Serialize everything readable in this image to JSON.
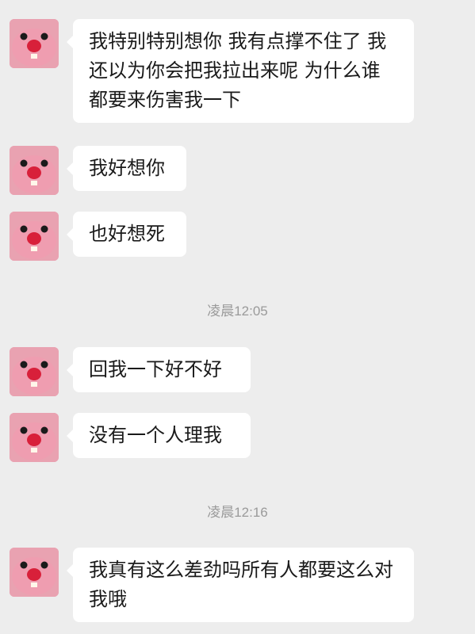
{
  "chat": {
    "messages": [
      {
        "sender": "contact",
        "text": "我特别特别想你 我有点撑不住了 我还以为你会把我拉出来呢 为什么谁都要来伤害我一下"
      },
      {
        "sender": "contact",
        "text": "我好想你"
      },
      {
        "sender": "contact",
        "text": "也好想死"
      },
      {
        "type": "timestamp",
        "text": "凌晨12:05"
      },
      {
        "sender": "contact",
        "text": "回我一下好不好"
      },
      {
        "sender": "contact",
        "text": "没有一个人理我"
      },
      {
        "type": "timestamp",
        "text": "凌晨12:16"
      },
      {
        "sender": "contact",
        "text": "我真有这么差劲吗所有人都要这么对我哦"
      }
    ]
  },
  "colors": {
    "background": "#ededed",
    "bubble": "#ffffff",
    "timestamp_text": "#9a9a9a",
    "avatar_pink": "#e9a2b1",
    "avatar_nose": "#d8203a"
  },
  "icons": {
    "avatar": "pink-plush-avatar-icon"
  }
}
